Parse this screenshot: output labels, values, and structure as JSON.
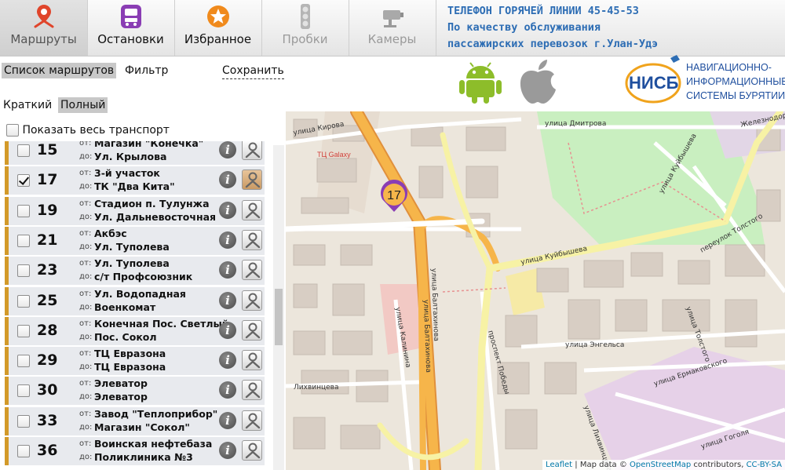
{
  "nav": [
    {
      "label": "Маршруты",
      "icon": "route-pin-icon"
    },
    {
      "label": "Остановки",
      "icon": "bus-stop-icon"
    },
    {
      "label": "Избранное",
      "icon": "star-icon"
    },
    {
      "label": "Пробки",
      "icon": "traffic-light-icon"
    },
    {
      "label": "Камеры",
      "icon": "camera-icon"
    }
  ],
  "hotline": {
    "line1": "ТЕЛЕФОН ГОРЯЧЕЙ ЛИНИИ 45-45-53",
    "line2": "По качеству обслуживания",
    "line3": "пассажирских перевозок г.Улан-Удэ"
  },
  "tabs": {
    "list": "Список маршрутов",
    "filter": "Фильтр",
    "save": "Сохранить"
  },
  "view": {
    "short": "Краткий",
    "full": "Полный"
  },
  "show_all": "Показать весь транспорт",
  "logo": {
    "abbr": "НИСБ",
    "line1": "НАВИГАЦИОННО-",
    "line2": "ИНФОРМАЦИОННЫЕ",
    "line3": "СИСТЕМЫ БУРЯТИИ"
  },
  "prefix": {
    "from": "от:",
    "to": "до:"
  },
  "routes": [
    {
      "num": "15",
      "from": "Магазин \"Конечка\"",
      "to": "Ул. Крылова",
      "checked": false
    },
    {
      "num": "17",
      "from": "3-й участок",
      "to": "ТК \"Два Кита\"",
      "checked": true
    },
    {
      "num": "19",
      "from": "Стадион п. Тулунжа",
      "to": "Ул. Дальневосточная",
      "checked": false
    },
    {
      "num": "21",
      "from": "Акбэс",
      "to": "Ул. Туполева",
      "checked": false
    },
    {
      "num": "23",
      "from": "Ул. Туполева",
      "to": "с/т Профсоюзник",
      "checked": false
    },
    {
      "num": "25",
      "from": "Ул. Водопадная",
      "to": "Военкомат",
      "checked": false
    },
    {
      "num": "28",
      "from": "Конечная Пос. Светлый",
      "to": "Пос. Сокол",
      "checked": false
    },
    {
      "num": "29",
      "from": "ТЦ Евразона",
      "to": "ТЦ Евразона",
      "checked": false
    },
    {
      "num": "30",
      "from": "Элеватор",
      "to": "Элеватор",
      "checked": false
    },
    {
      "num": "33",
      "from": "Завод \"Теплоприбор\"",
      "to": "Магазин \"Сокол\"",
      "checked": false
    },
    {
      "num": "36",
      "from": "Воинская нефтебаза",
      "to": "Поликлиника №3",
      "checked": false
    }
  ],
  "map": {
    "marker": "17",
    "labels": {
      "kirova": "улица Кирова",
      "dimitrova": "улица Дмитрова",
      "kuibysheva_v": "улица Куйбышева",
      "kuibysheva_h": "улица Куйбышева",
      "galaxy": "ТЦ Galaxy",
      "tolstogo_lane": "переулок Толстого",
      "tolstogo": "улица Толстого",
      "kalinina": "улица Калинина",
      "baltakhinova": "улица Балтахинова",
      "baltakhinova2": "улица Балтахинова",
      "pobedy": "проспект Победы",
      "engelsa": "улица Энгельса",
      "ermakovskogo": "улица Ермаковского",
      "likhvintseva": "улица Лихвинцева",
      "lkhvintseva2": "Лихвинцева",
      "gogolya": "улица Гоголя",
      "zhelezno": "Железнодорож"
    }
  },
  "attribution": {
    "leaflet": "Leaflet",
    "mid": " | Map data © ",
    "osm": "OpenStreetMap",
    "contrib": " contributors, ",
    "lic": "CC-BY-SA"
  },
  "colors": {
    "accent": "#2d6db4",
    "route_bar": "#d39a29",
    "road_major": "#f2a33a",
    "park": "#c9efc0"
  }
}
